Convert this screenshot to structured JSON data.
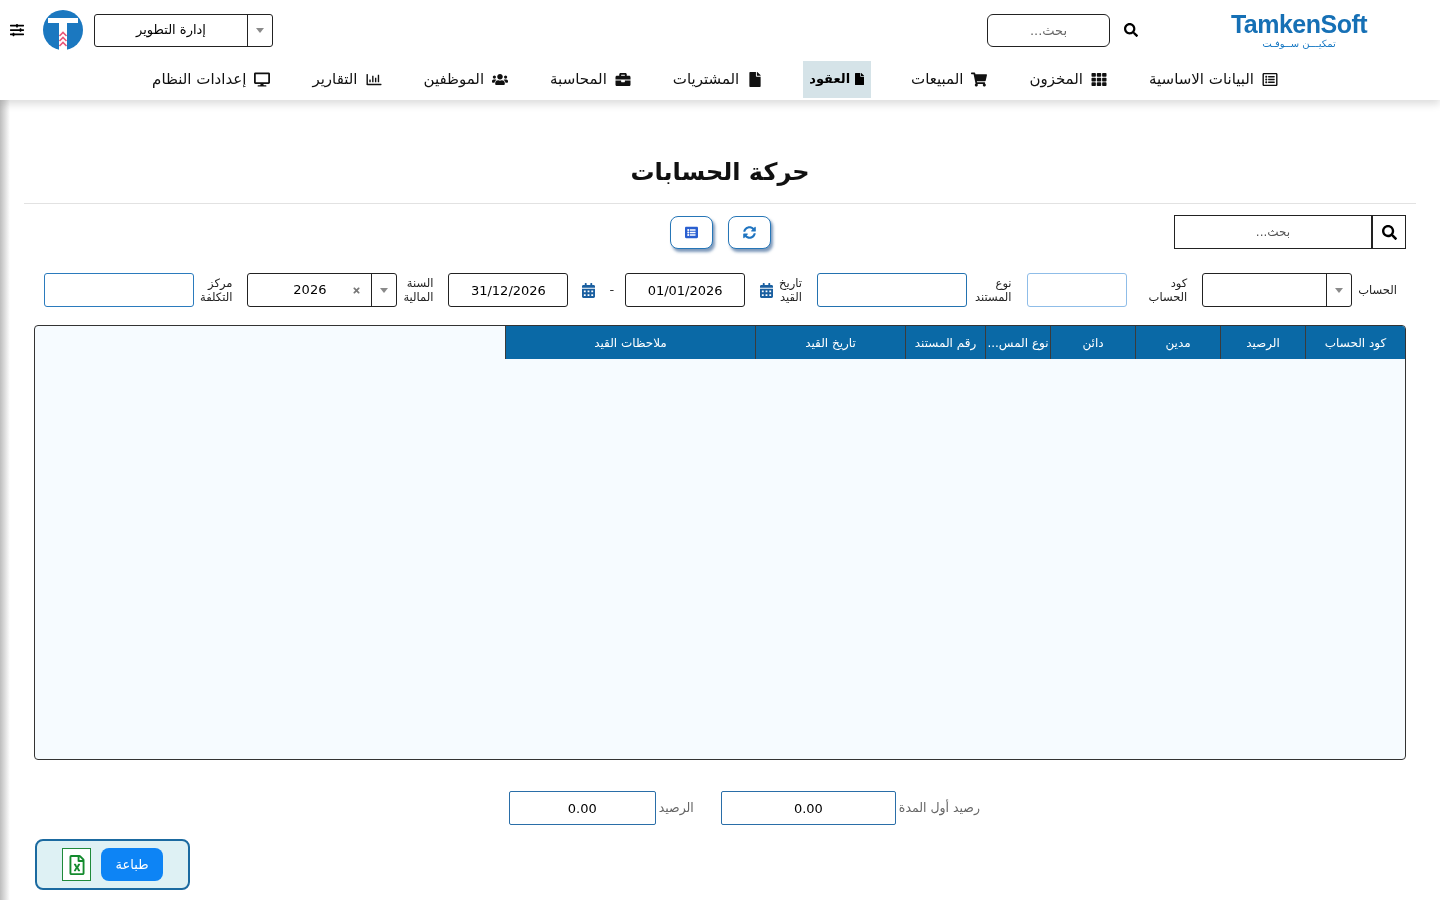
{
  "header": {
    "logo": {
      "wordmark": "TamkenSoft",
      "tagline": "تمكيـــن ســوفـت"
    },
    "search": {
      "placeholder": "بحث..."
    },
    "department": {
      "value": "إدارة التطوير"
    }
  },
  "nav": [
    {
      "label": "البيانات الاساسية",
      "selected": false
    },
    {
      "label": "المخزون",
      "selected": false
    },
    {
      "label": "المبيعات",
      "selected": false
    },
    {
      "label": "العقود",
      "selected": true
    },
    {
      "label": "المشتريات",
      "selected": false
    },
    {
      "label": "المحاسبة",
      "selected": false
    },
    {
      "label": "الموظفين",
      "selected": false
    },
    {
      "label": "التقارير",
      "selected": false
    },
    {
      "label": "إعدادات النظام",
      "selected": false
    }
  ],
  "page": {
    "title": "حركة الحسابات"
  },
  "toolbar": {
    "search": {
      "placeholder": "بحث..."
    }
  },
  "filters": {
    "account": {
      "label": "الحساب"
    },
    "account_code": {
      "label": "كود الحساب"
    },
    "document_type": {
      "label": "نوع المستند"
    },
    "entry_date": {
      "label": "تاريخ القيد",
      "from": "01/01/2026",
      "separator": "-",
      "to": "31/12/2026"
    },
    "fiscal_year": {
      "label": "السنة المالية",
      "value": "2026"
    },
    "cost_center": {
      "label": "مركز التكلفة"
    }
  },
  "table": {
    "columns": [
      "كود الحساب",
      "الرصيد",
      "مدين",
      "دائن",
      "نوع المس...",
      "رقم المستند",
      "تاريخ القيد",
      "ملاحظات القيد"
    ]
  },
  "totals": [
    {
      "label": "رصيد أول المدة",
      "value": "0.00"
    },
    {
      "label": "الرصيد",
      "value": "0.00"
    }
  ],
  "actions": {
    "print": "طباعة"
  }
}
